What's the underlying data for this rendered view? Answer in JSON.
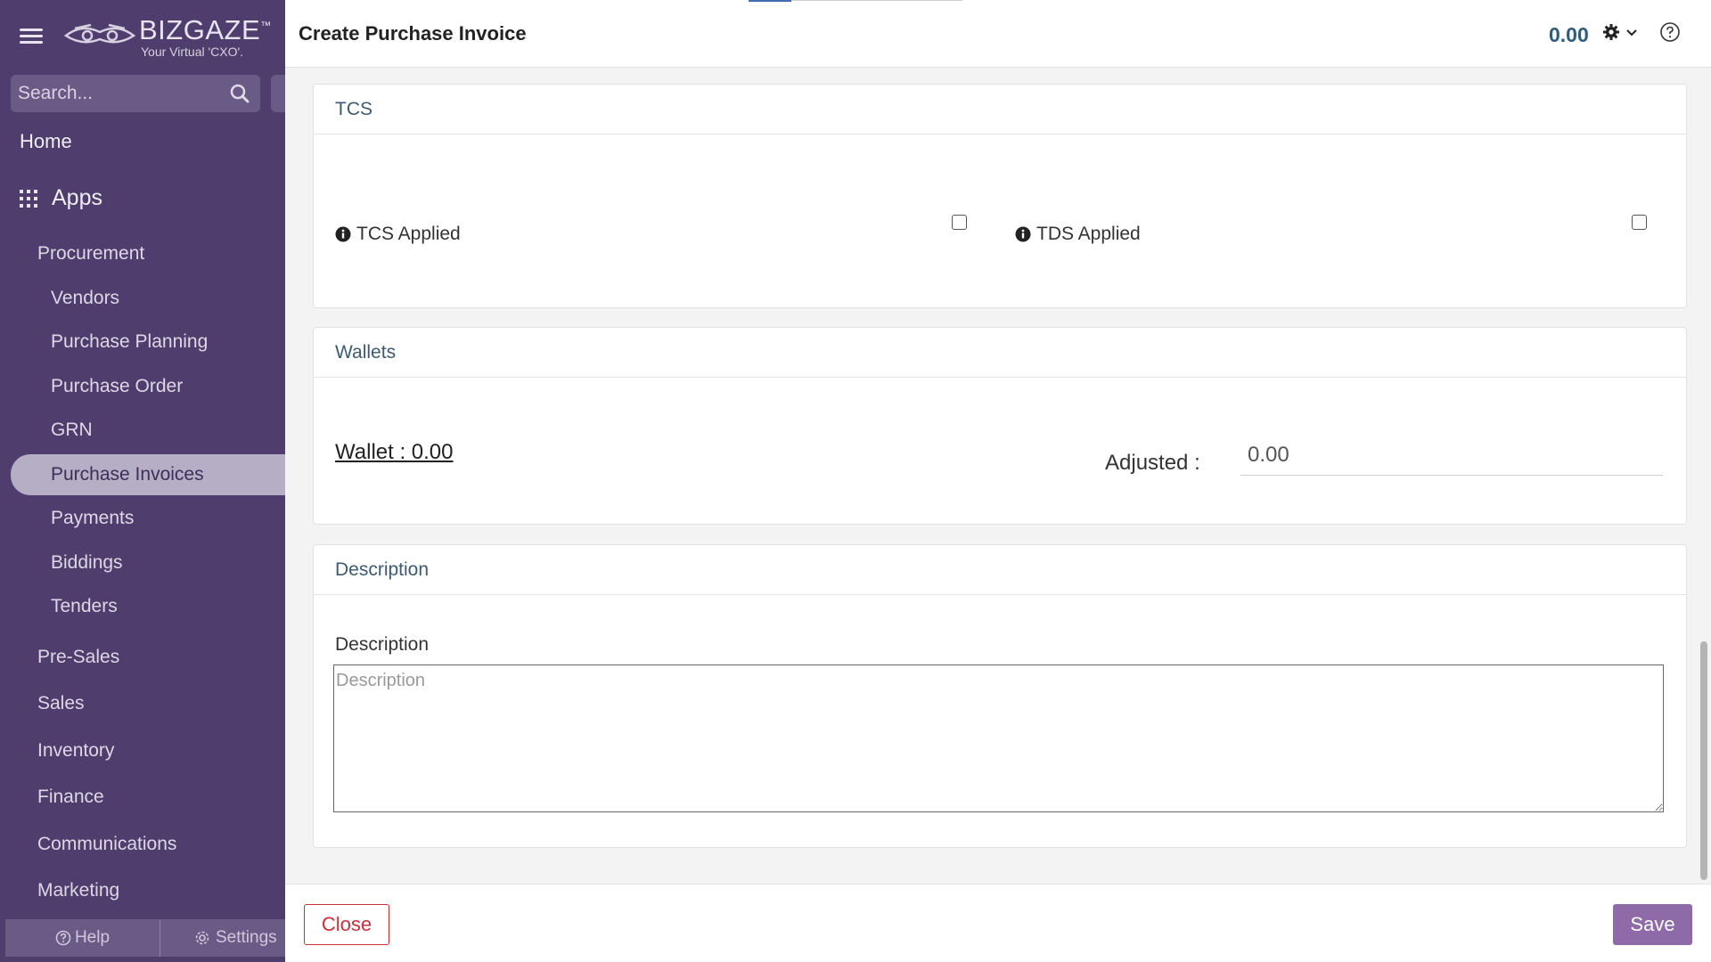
{
  "sidebar": {
    "logo_text": "BIZGAZE",
    "logo_tm": "™",
    "logo_tagline": "Your Virtual 'CXO'.",
    "search_placeholder": "Search...",
    "home_label": "Home",
    "apps_label": "Apps",
    "sections": [
      {
        "label": "Procurement"
      },
      {
        "label": "Pre-Sales"
      },
      {
        "label": "Sales"
      },
      {
        "label": "Inventory"
      },
      {
        "label": "Finance"
      },
      {
        "label": "Communications"
      },
      {
        "label": "Marketing"
      }
    ],
    "procurement_items": [
      {
        "label": "Vendors"
      },
      {
        "label": "Purchase Planning"
      },
      {
        "label": "Purchase Order"
      },
      {
        "label": "GRN"
      },
      {
        "label": "Purchase Invoices",
        "active": true
      },
      {
        "label": "Payments"
      },
      {
        "label": "Biddings"
      },
      {
        "label": "Tenders"
      }
    ],
    "footer": {
      "help_label": "Help",
      "settings_label": "Settings"
    }
  },
  "header": {
    "title": "Create Purchase Invoice",
    "amount": "0.00"
  },
  "tcs_card": {
    "title": "TCS",
    "tcs_applied_label": "TCS Applied",
    "tcs_applied_checked": false,
    "tds_applied_label": "TDS Applied",
    "tds_applied_checked": false
  },
  "wallets_card": {
    "title": "Wallets",
    "wallet_link": "Wallet : 0.00",
    "adjusted_label": "Adjusted :",
    "adjusted_value": "0.00"
  },
  "description_card": {
    "title": "Description",
    "field_label": "Description",
    "placeholder": "Description",
    "value": ""
  },
  "footer": {
    "close_label": "Close",
    "save_label": "Save"
  },
  "colors": {
    "sidebar_bg": "#4f3e6d",
    "active_item_bg": "#b6aec4",
    "save_button": "#8e6ba8",
    "close_button_border": "#c8303a",
    "amount_text": "#2f5d7c"
  },
  "icons": [
    "hamburger-icon",
    "logo-owl-icon",
    "search-icon",
    "apps-grid-icon",
    "info-icon",
    "gear-icon",
    "chevron-down-icon",
    "help-circle-icon",
    "question-circle-icon",
    "settings-gear-icon"
  ]
}
